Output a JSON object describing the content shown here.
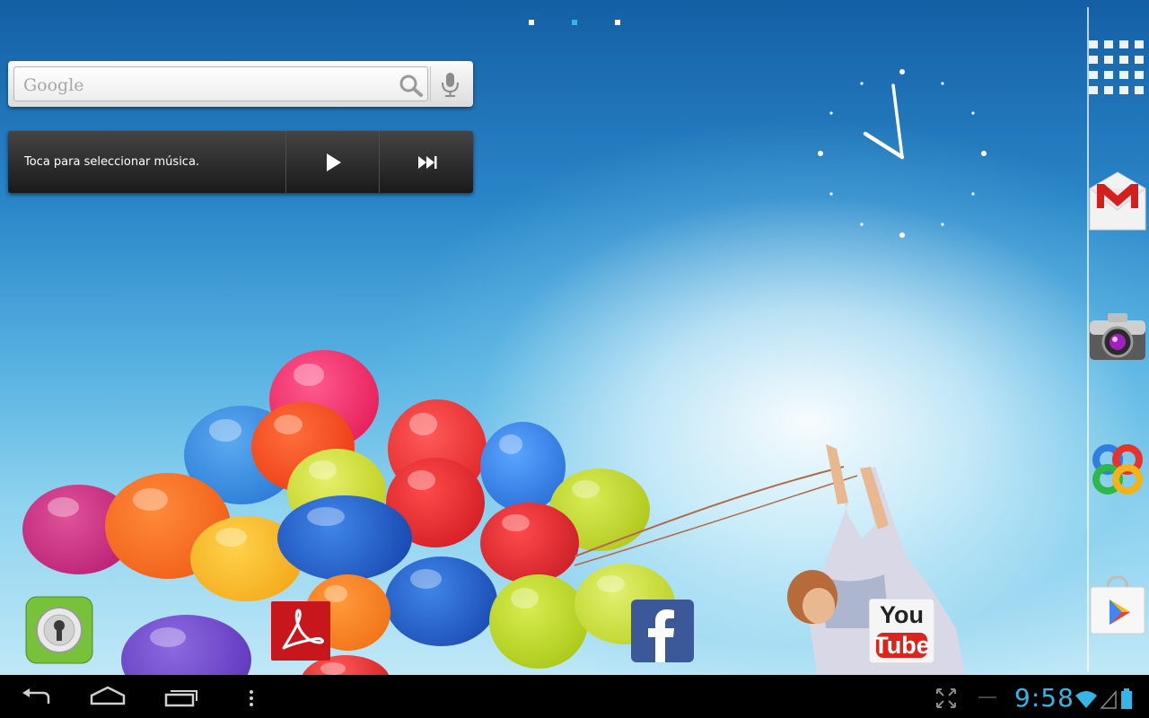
{
  "search_widget": {
    "logo_text": "Google"
  },
  "music_widget": {
    "prompt": "Toca para seleccionar música."
  },
  "dock": {
    "items": [
      {
        "name": "Gmail",
        "icon": "gmail-icon"
      },
      {
        "name": "Camera",
        "icon": "camera-icon"
      },
      {
        "name": "GO Launcher",
        "icon": "go-launcher-icon"
      },
      {
        "name": "Play Store",
        "icon": "play-store-icon"
      }
    ]
  },
  "home_shortcuts": [
    {
      "icon": "go-locker-icon"
    },
    {
      "icon": "adobe-reader-icon"
    },
    {
      "icon": "facebook-icon"
    },
    {
      "icon": "youtube-icon",
      "label_top": "You",
      "label_bottom": "Tube"
    }
  ],
  "status_bar": {
    "time": "9:58"
  },
  "colors": {
    "accent": "#33b5e5",
    "navbar": "#000000"
  }
}
